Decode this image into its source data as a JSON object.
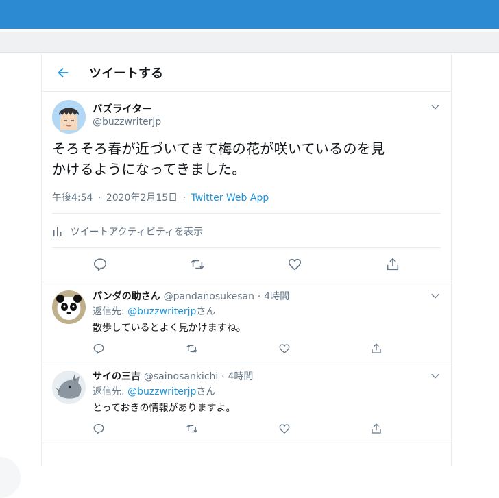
{
  "header": {
    "title": "ツイートする"
  },
  "tweet": {
    "author_name": "バズライター",
    "author_handle": "@buzzwriterjp",
    "text_line1": "そろそろ春が近づいてきて梅の花が咲いているのを見",
    "text_line2": "かけるようになってきました。",
    "time": "午後4:54",
    "sep": "·",
    "date": "2020年2月15日",
    "source": "Twitter Web App",
    "activity_label": "ツイートアクティビティを表示"
  },
  "replies": [
    {
      "name": "パンダの助さん",
      "handle": "@pandanosukesan",
      "sep": "·",
      "time": "4時間",
      "reply_prefix": "返信先: ",
      "reply_to": "@buzzwriterjp",
      "reply_suffix": "さん",
      "text": "散歩しているとよく見かけますね。"
    },
    {
      "name": "サイの三吉",
      "handle": "@sainosankichi",
      "sep": "·",
      "time": "4時間",
      "reply_prefix": "返信先: ",
      "reply_to": "@buzzwriterjp",
      "reply_suffix": "さん",
      "text": "とっておきの情報がありますよ。"
    }
  ],
  "icons": {
    "back": "back-arrow-icon",
    "more": "chevron-down-icon",
    "reply": "reply-icon",
    "retweet": "retweet-icon",
    "like": "like-icon",
    "share": "share-icon",
    "activity": "bar-chart-icon"
  },
  "colors": {
    "accent": "#1b95e0",
    "topbar": "#2b8ad1",
    "secondary_text": "#657786",
    "border": "#e6ecf0"
  }
}
